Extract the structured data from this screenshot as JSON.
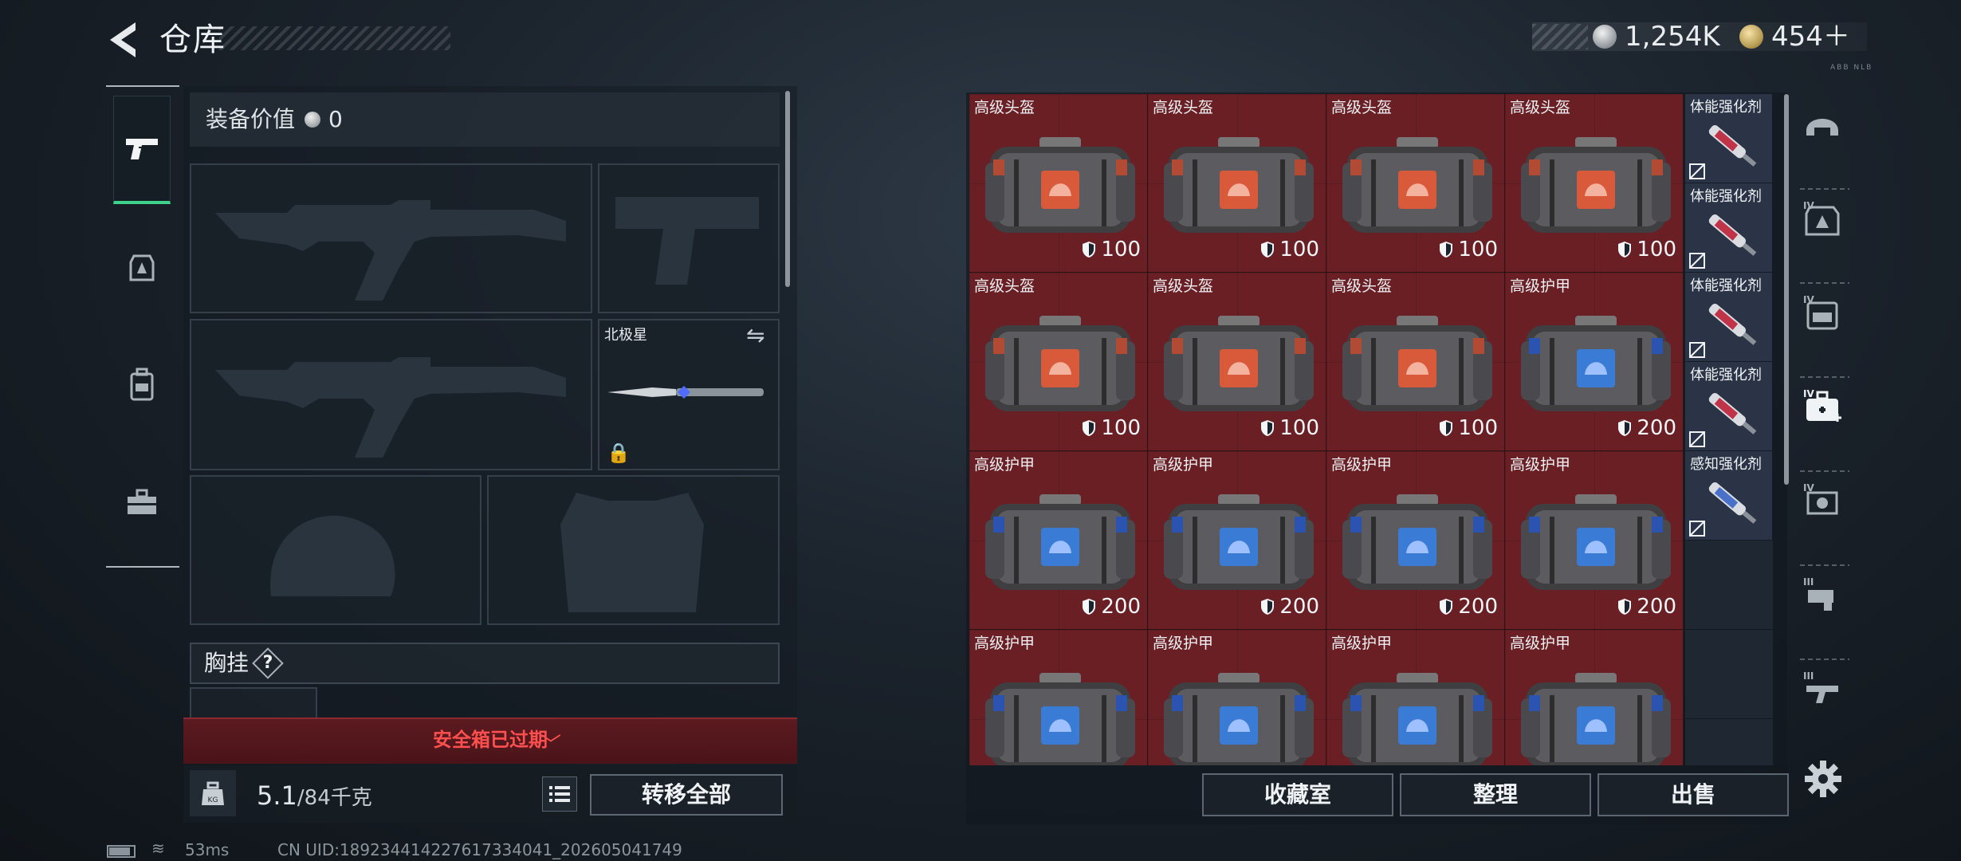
{
  "header": {
    "title": "仓库",
    "back_icon": "chevron-left-icon",
    "silver_amount": "1,254K",
    "gold_amount": "454＋",
    "tiny_label": "ABB NLB"
  },
  "left_nav": {
    "items": [
      {
        "name": "weapons",
        "icon": "pistol-icon",
        "selected": true
      },
      {
        "name": "armor",
        "icon": "armor-icon"
      },
      {
        "name": "backpack",
        "icon": "backpack-icon"
      },
      {
        "name": "case",
        "icon": "toolbox-icon"
      }
    ]
  },
  "equipment": {
    "value_label": "装备价值",
    "value": "0",
    "melee_name": "北极星",
    "chest_label": "胸挂",
    "help_mark": "?"
  },
  "safe_box": {
    "text": "安全箱已过期"
  },
  "weight": {
    "current": "5.1",
    "max": "/84千克"
  },
  "buttons": {
    "transfer_all": "转移全部",
    "collection": "收藏室",
    "sort": "整理",
    "sell": "出售"
  },
  "storage": {
    "items": [
      {
        "label": "高级头盔",
        "durability": "100",
        "type": "helmet"
      },
      {
        "label": "高级头盔",
        "durability": "100",
        "type": "helmet"
      },
      {
        "label": "高级头盔",
        "durability": "100",
        "type": "helmet"
      },
      {
        "label": "高级头盔",
        "durability": "100",
        "type": "helmet"
      },
      {
        "label": "高级头盔",
        "durability": "100",
        "type": "helmet"
      },
      {
        "label": "高级头盔",
        "durability": "100",
        "type": "helmet"
      },
      {
        "label": "高级头盔",
        "durability": "100",
        "type": "helmet"
      },
      {
        "label": "高级护甲",
        "durability": "200",
        "type": "armor"
      },
      {
        "label": "高级护甲",
        "durability": "200",
        "type": "armor"
      },
      {
        "label": "高级护甲",
        "durability": "200",
        "type": "armor"
      },
      {
        "label": "高级护甲",
        "durability": "200",
        "type": "armor"
      },
      {
        "label": "高级护甲",
        "durability": "200",
        "type": "armor"
      },
      {
        "label": "高级护甲",
        "durability": "",
        "type": "armor"
      },
      {
        "label": "高级护甲",
        "durability": "",
        "type": "armor"
      },
      {
        "label": "高级护甲",
        "durability": "",
        "type": "armor"
      },
      {
        "label": "高级护甲",
        "durability": "",
        "type": "armor"
      }
    ],
    "small_items": [
      {
        "label": "体能强化剂",
        "color": "#c0344a"
      },
      {
        "label": "体能强化剂",
        "color": "#c0344a"
      },
      {
        "label": "体能强化剂",
        "color": "#c0344a"
      },
      {
        "label": "体能强化剂",
        "color": "#c0344a"
      },
      {
        "label": "感知强化剂",
        "color": "#4a70c8"
      }
    ]
  },
  "right_nav": {
    "items": [
      {
        "icon": "helmet-icon",
        "tier": ""
      },
      {
        "icon": "armor-tier-icon",
        "tier": "IV"
      },
      {
        "icon": "backpack-tier-icon",
        "tier": "IV"
      },
      {
        "icon": "medkit-icon",
        "tier": "IV",
        "selected": true
      },
      {
        "icon": "ammo-tier-icon",
        "tier": "IV"
      },
      {
        "icon": "attachment-tier-icon",
        "tier": "III"
      },
      {
        "icon": "gun-tier-icon",
        "tier": "III"
      }
    ]
  },
  "status": {
    "ping": "53ms",
    "uid": "CN UID:1892344142276173340​41_202605041749"
  },
  "colors": {
    "item_bg": "#6a1f25",
    "small_item_bg": "#2b3446",
    "selected_accent": "#3ed28a",
    "warning": "#ff4f4f"
  }
}
